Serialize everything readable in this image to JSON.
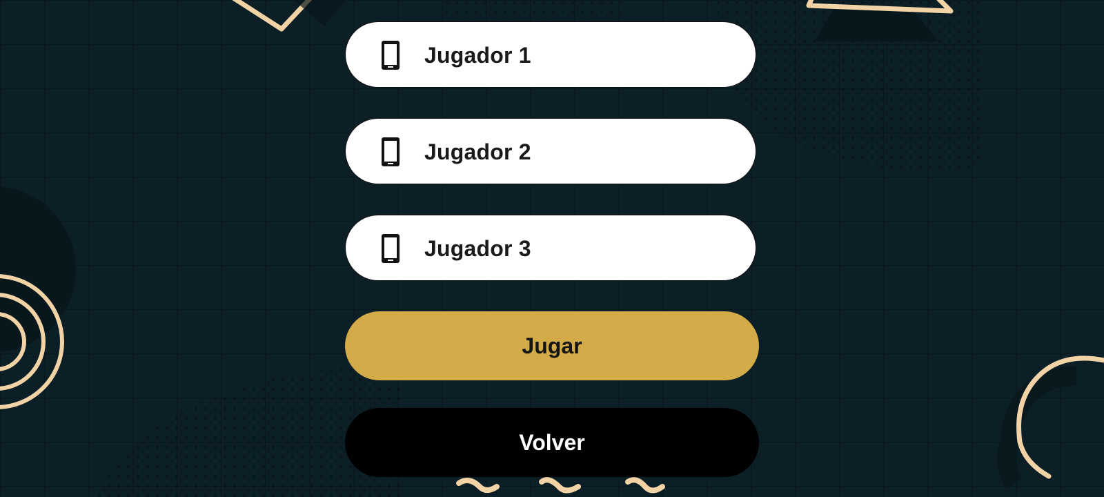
{
  "players": [
    {
      "label": "Jugador 1",
      "icon": "phone-icon"
    },
    {
      "label": "Jugador 2",
      "icon": "phone-icon"
    },
    {
      "label": "Jugador 3",
      "icon": "phone-icon"
    }
  ],
  "actions": {
    "play_label": "Jugar",
    "back_label": "Volver"
  },
  "colors": {
    "background": "#0c1f26",
    "field": "#ffffff",
    "play_button": "#d3ab48",
    "back_button": "#000000",
    "decoration": "#f1d3a6"
  }
}
